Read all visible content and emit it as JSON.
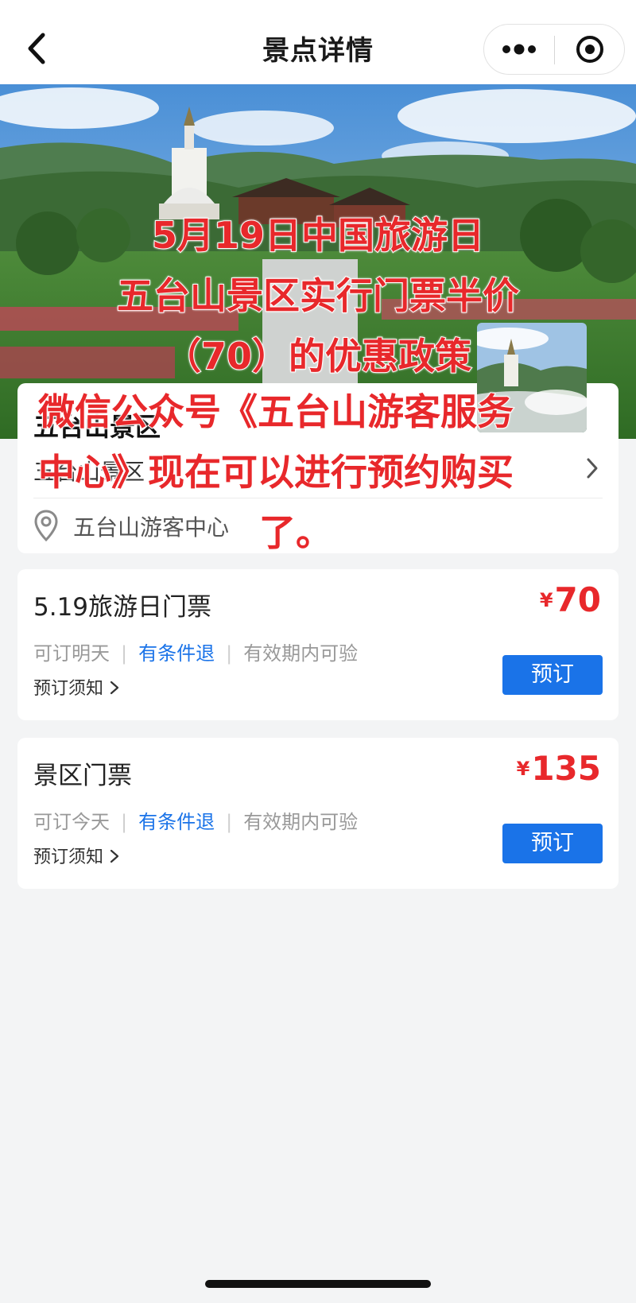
{
  "navbar": {
    "title": "景点详情",
    "back_icon": "chevron-left-icon",
    "more_icon": "more-dots-icon",
    "close_icon": "target-close-icon"
  },
  "overlay": {
    "line1": "5月19日中国旅游日",
    "line2": "五台山景区实行门票半价",
    "line3": "（70）的优惠政策",
    "line4": "微信公众号《五台山游客服务",
    "line5": "中心》现在可以进行预约购买",
    "line6": "了。"
  },
  "info": {
    "name": "五台山景区",
    "subtitle": "五台山景区",
    "location": "五台山游客中心"
  },
  "tickets": [
    {
      "name": "5.19旅游日门票",
      "currency": "¥",
      "price": "70",
      "tag1": "可订明天",
      "tag2": "有条件退",
      "tag3": "有效期内可验",
      "notice": "预订须知",
      "book": "预订"
    },
    {
      "name": "景区门票",
      "currency": "¥",
      "price": "135",
      "tag1": "可订今天",
      "tag2": "有条件退",
      "tag3": "有效期内可验",
      "notice": "预订须知",
      "book": "预订"
    }
  ],
  "colors": {
    "accent_blue": "#1a73e8",
    "price_red": "#e8282b",
    "overlay_red": "#e8282b"
  }
}
